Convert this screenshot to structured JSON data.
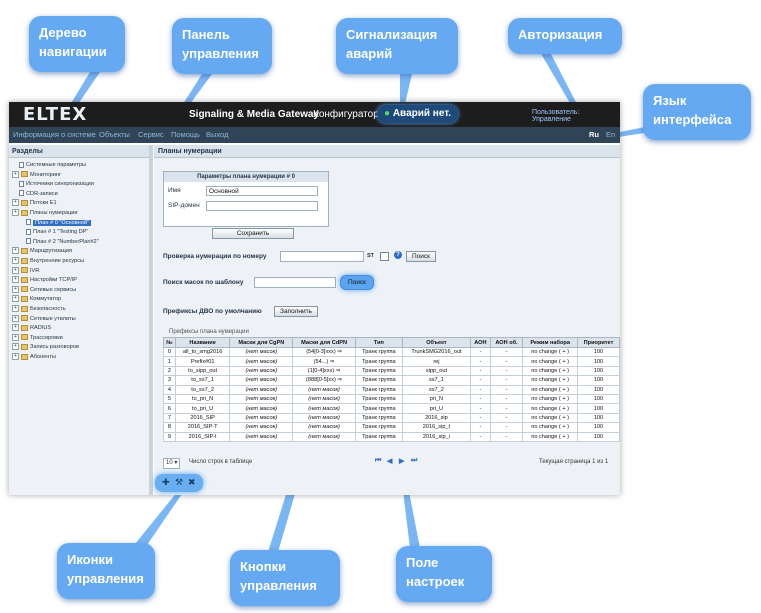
{
  "callouts": {
    "nav_tree": "Дерево навигации",
    "control_panel": "Панель управления",
    "alarms": "Сигнализация аварий",
    "auth": "Авторизация",
    "lang": "Язык интерфейса",
    "icons": "Иконки управления",
    "buttons": "Кнопки управления",
    "settings": "Поле настроек"
  },
  "header": {
    "logo": "ELTEX",
    "title": "Signaling & Media Gateway",
    "subtitle": "Конфигуратор",
    "alarm": "Аварий нет.",
    "user": "Пользователь: Управление"
  },
  "menu": [
    "Информация о системе",
    "Объекты",
    "Сервис",
    "Помощь",
    "Выход"
  ],
  "languages": [
    "Ru",
    "En"
  ],
  "left": {
    "title": "Разделы",
    "tree": [
      {
        "label": "Системные параметры",
        "icon": "doc",
        "level": 0
      },
      {
        "label": "Мониторинг",
        "icon": "folder",
        "level": 0,
        "plus": true
      },
      {
        "label": "Источники синхронизации",
        "icon": "doc",
        "level": 0
      },
      {
        "label": "CDR-записи",
        "icon": "doc",
        "level": 0
      },
      {
        "label": "Потоки E1",
        "icon": "folder",
        "level": 0,
        "plus": true
      },
      {
        "label": "Планы нумерации",
        "icon": "folder",
        "level": 0,
        "plus": true
      },
      {
        "label": "План # 0 \"Основной\"",
        "icon": "doc",
        "level": 1,
        "selected": true
      },
      {
        "label": "План # 1 \"Testing DP\"",
        "icon": "doc",
        "level": 1
      },
      {
        "label": "План # 2 \"NumberPlan#2\"",
        "icon": "doc",
        "level": 1
      },
      {
        "label": "Маршрутизация",
        "icon": "folder",
        "level": 0,
        "plus": true
      },
      {
        "label": "Внутренние ресурсы",
        "icon": "folder",
        "level": 0,
        "plus": true
      },
      {
        "label": "IVR",
        "icon": "folder",
        "level": 0,
        "plus": true
      },
      {
        "label": "Настройки TCP/IP",
        "icon": "folder",
        "level": 0,
        "plus": true
      },
      {
        "label": "Сетевые сервисы",
        "icon": "folder",
        "level": 0,
        "plus": true
      },
      {
        "label": "Коммутатор",
        "icon": "folder",
        "level": 0,
        "plus": true
      },
      {
        "label": "Безопасность",
        "icon": "folder",
        "level": 0,
        "plus": true
      },
      {
        "label": "Сетевые утилиты",
        "icon": "folder",
        "level": 0,
        "plus": true
      },
      {
        "label": "RADIUS",
        "icon": "folder",
        "level": 0,
        "plus": true
      },
      {
        "label": "Трассировки",
        "icon": "folder",
        "level": 0,
        "plus": true
      },
      {
        "label": "Запись разговоров",
        "icon": "folder",
        "level": 0,
        "plus": true
      },
      {
        "label": "Абоненты",
        "icon": "folder",
        "level": 0,
        "plus": true
      }
    ]
  },
  "right": {
    "title": "Планы нумерации",
    "params": {
      "title": "Параметры плана нумерации # 0",
      "name_label": "Имя",
      "name_value": "Основной",
      "sip_label": "SIP-домен",
      "sip_value": "",
      "save": "Сохранить"
    },
    "check_label": "Проверка нумерации по номеру",
    "check_suffix": "ST",
    "help_icon": "?",
    "search": "Поиск",
    "mask_label": "Поиск масок по шаблону",
    "mask_search": "Поиск",
    "dvo_label": "Префиксы ДВО по умолчанию",
    "fill": "Заполнить",
    "prefix_label": "Префиксы плана нумерации",
    "table": {
      "columns": [
        "№",
        "Название",
        "Маски для CgPN",
        "Маски для CdPN",
        "Тип",
        "Объект",
        "АОН",
        "АОН об.",
        "Режим набора",
        "Приоритет"
      ],
      "rows": [
        [
          "0",
          "all_to_smg2016",
          "(нет масок)",
          "(54[0-3]xxx) ⇒",
          "Транк группа",
          "TrunkSMG2016_out",
          "-",
          "-",
          "no change ( + )",
          "100"
        ],
        [
          "1",
          "Prefix#01",
          "(нет масок)",
          "(54...) ⇒",
          "Транк группа",
          "rej",
          "-",
          "-",
          "no change ( + )",
          "100"
        ],
        [
          "2",
          "to_sipp_out",
          "(нет масок)",
          "(1[0-4]xxx) ⇒",
          "Транк группа",
          "sipp_out",
          "-",
          "-",
          "no change ( + )",
          "100"
        ],
        [
          "3",
          "to_ss7_1",
          "(нет масок)",
          "(888[0-5]xx) ⇒",
          "Транк группа",
          "ss7_1",
          "-",
          "-",
          "no change ( + )",
          "100"
        ],
        [
          "4",
          "to_ss7_2",
          "(нет масок)",
          "(нет масок)",
          "Транк группа",
          "ss7_2",
          "-",
          "-",
          "no change ( + )",
          "100"
        ],
        [
          "5",
          "to_pri_N",
          "(нет масок)",
          "(нет масок)",
          "Транк группа",
          "pri_N",
          "-",
          "-",
          "no change ( + )",
          "100"
        ],
        [
          "6",
          "to_pri_U",
          "(нет масок)",
          "(нет масок)",
          "Транк группа",
          "pri_U",
          "-",
          "-",
          "no change ( + )",
          "100"
        ],
        [
          "7",
          "2016_SIP",
          "(нет масок)",
          "(нет масок)",
          "Транк группа",
          "2016_sip",
          "-",
          "-",
          "no change ( + )",
          "100"
        ],
        [
          "8",
          "2016_SIP-T",
          "(нет масок)",
          "(нет масок)",
          "Транк группа",
          "2016_sip_t",
          "-",
          "-",
          "no change ( + )",
          "100"
        ],
        [
          "9",
          "2016_SIP-I",
          "(нет масок)",
          "(нет масок)",
          "Транк группа",
          "2016_sip_i",
          "-",
          "-",
          "no change ( + )",
          "100"
        ]
      ]
    },
    "pager": {
      "rows_per_page": "10",
      "rows_label": "Число строк в таблице",
      "page_info": "Текущая страница 1 из 1"
    }
  },
  "icons_panel": [
    "add-icon",
    "tools-icon",
    "delete-icon"
  ]
}
